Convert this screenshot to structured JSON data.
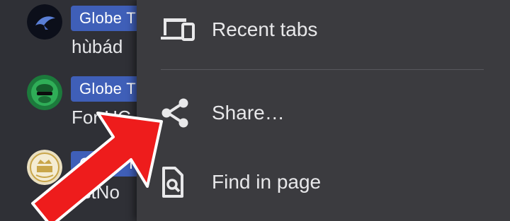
{
  "chats": [
    {
      "tag": "Globe T",
      "message": "hùbád",
      "avatar": "dark-bird-avatar"
    },
    {
      "tag": "Globe T",
      "message": "For HC",
      "avatar": "green-mascot-avatar"
    },
    {
      "tag": "Globe T",
      "message": "astNo",
      "avatar": "vip-badge-avatar"
    }
  ],
  "menu": {
    "items": [
      {
        "label": "Recent tabs",
        "icon": "devices-icon"
      },
      {
        "label": "Share…",
        "icon": "share-icon"
      },
      {
        "label": "Find in page",
        "icon": "find-in-page-icon"
      }
    ]
  },
  "annotation": {
    "arrow_color": "#ee1c1c",
    "points_to": "Share…"
  },
  "colors": {
    "background": "#2f3036",
    "menu_background": "#3b3b3f",
    "tag_background": "#3f5fb8",
    "text": "#e8e8ea"
  }
}
